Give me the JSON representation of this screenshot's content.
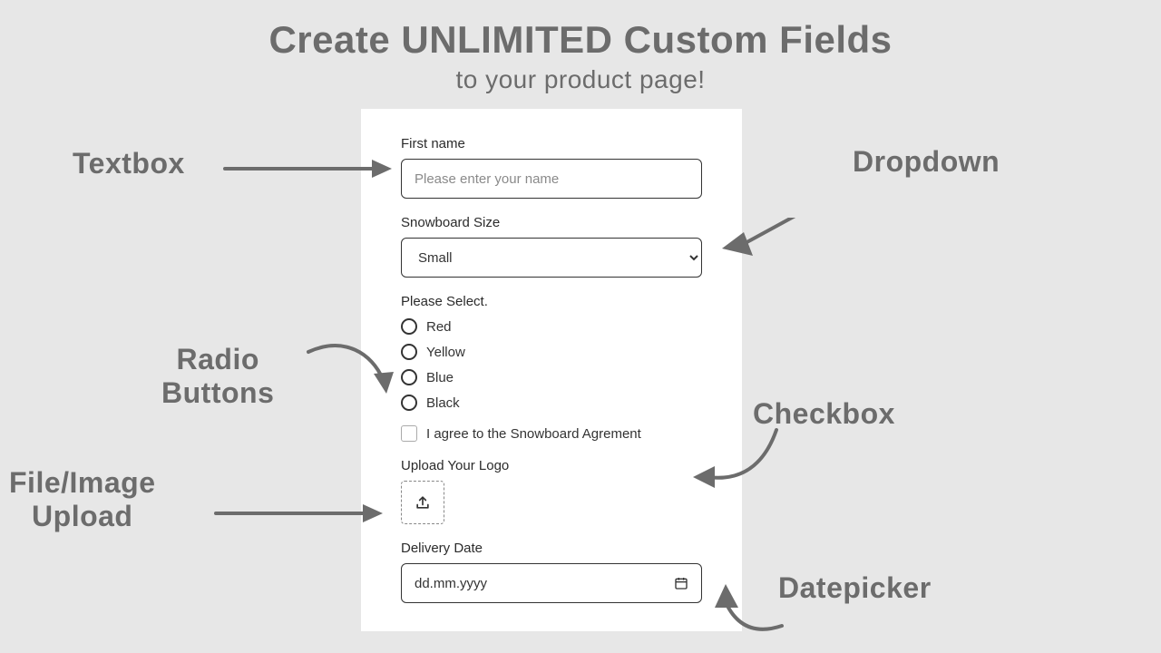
{
  "heading": {
    "title": "Create UNLIMITED Custom Fields",
    "subtitle": "to your product page!"
  },
  "callouts": {
    "textbox": "Textbox",
    "dropdown": "Dropdown",
    "radio": "Radio\nButtons",
    "checkbox": "Checkbox",
    "upload": "File/Image\nUpload",
    "datepicker": "Datepicker"
  },
  "form": {
    "first_name": {
      "label": "First name",
      "placeholder": "Please enter your name"
    },
    "size": {
      "label": "Snowboard Size",
      "selected": "Small"
    },
    "radio": {
      "label": "Please Select.",
      "options": [
        "Red",
        "Yellow",
        "Blue",
        "Black"
      ]
    },
    "agree": {
      "label": "I agree to the Snowboard Agrement"
    },
    "upload": {
      "label": "Upload Your Logo"
    },
    "date": {
      "label": "Delivery Date",
      "placeholder": "dd.mm.yyyy"
    }
  }
}
